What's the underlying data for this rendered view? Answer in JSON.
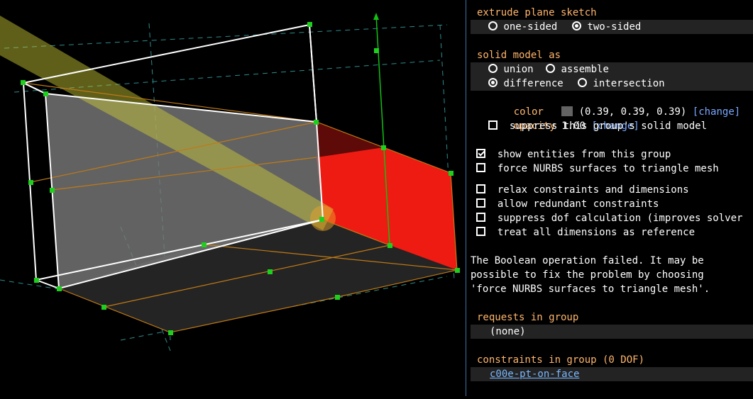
{
  "viewport": {
    "label": "3d-viewport"
  },
  "panel": {
    "extrude": {
      "heading": "extrude plane sketch",
      "options": [
        {
          "label": "one-sided",
          "selected": false
        },
        {
          "label": "two-sided",
          "selected": true
        }
      ]
    },
    "solid": {
      "heading": "solid model as",
      "union": "union",
      "assemble": "assemble",
      "difference": "difference",
      "intersection": "intersection",
      "selected": "difference",
      "color_label": "color",
      "color_value": "(0.39, 0.39, 0.39)",
      "color_change": "[change]",
      "color_hex": "#636363",
      "opacity_label": "opacity",
      "opacity_value": "1.00",
      "opacity_change": "[change]",
      "suppress_solid": "suppress this group's solid model"
    },
    "options": {
      "show_entities": "show entities from this group",
      "force_nurbs": "force NURBS surfaces to triangle mesh",
      "relax": "relax constraints and dimensions",
      "allow_redundant": "allow redundant constraints",
      "suppress_dof": "suppress dof calculation (improves solver",
      "treat_reference": "treat all dimensions as reference"
    },
    "error": {
      "line1": "The Boolean operation failed. It may be",
      "line2": "possible to fix the problem by choosing",
      "line3": "'force NURBS surfaces to triangle mesh'."
    },
    "requests": {
      "heading": "requests in group",
      "value": "(none)"
    },
    "constraints": {
      "heading": "constraints in group (0 DOF)",
      "item": "c00e-pt-on-face"
    }
  }
}
